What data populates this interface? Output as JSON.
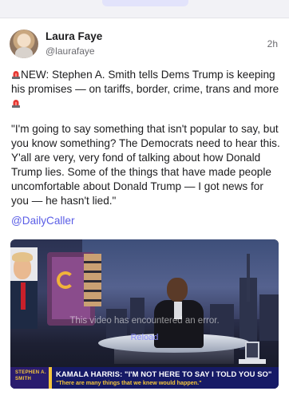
{
  "post": {
    "author_name": "Laura Faye",
    "author_handle": "@laurafaye",
    "time": "2h",
    "text_line1_prefix": "NEW: Stephen A. Smith tells Dems Trump is keeping his promises — on tariffs, border, crime, trans and more",
    "quote": "\"I'm going to say something that isn't popular to say, but you know something? The Democrats need to hear this. Y'all are very, very fond of talking about how Donald Trump lies. Some of the things that have made people uncomfortable about Donald Trump — I got news for you — he hasn't lied.\"",
    "mention": "@DailyCaller",
    "emoji": "siren"
  },
  "video": {
    "error_message": "This video has encountered an error.",
    "reload_label": "Reload",
    "show_logo_line1": "STEPHEN A.",
    "show_logo_line2": "SMITH",
    "headline": "KAMALA HARRIS: \"I'M NOT HERE TO SAY I TOLD YOU SO\"",
    "subquote": "\"There are many things that we knew would happen.\""
  },
  "colors": {
    "link": "#5a5de6",
    "lower_third_bg": "#161a66",
    "lower_third_accent": "#f4c53b"
  }
}
